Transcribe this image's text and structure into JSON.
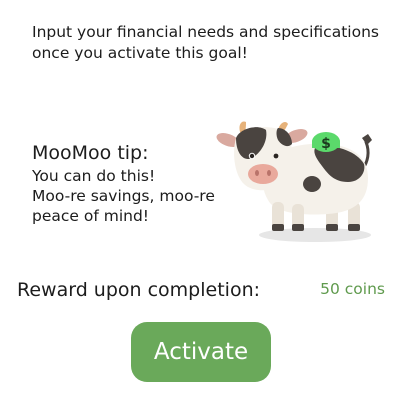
{
  "intro": {
    "text": "Input your financial needs and specifications once you activate this goal!"
  },
  "tip": {
    "title": "MooMoo tip:",
    "line1": "You can do this!",
    "line2": "Moo-re savings, moo-re peace of mind!"
  },
  "mascot": {
    "icon": "cow-mascot-icon",
    "badge_icon": "dollar-sign-icon",
    "badge_symbol": "$"
  },
  "reward": {
    "label": "Reward upon completion:",
    "value": "50 coins"
  },
  "actions": {
    "activate_label": "Activate"
  },
  "colors": {
    "accent_green": "#6aa95a",
    "reward_text_green": "#5f9a4d",
    "badge_green": "#5bd96b"
  }
}
